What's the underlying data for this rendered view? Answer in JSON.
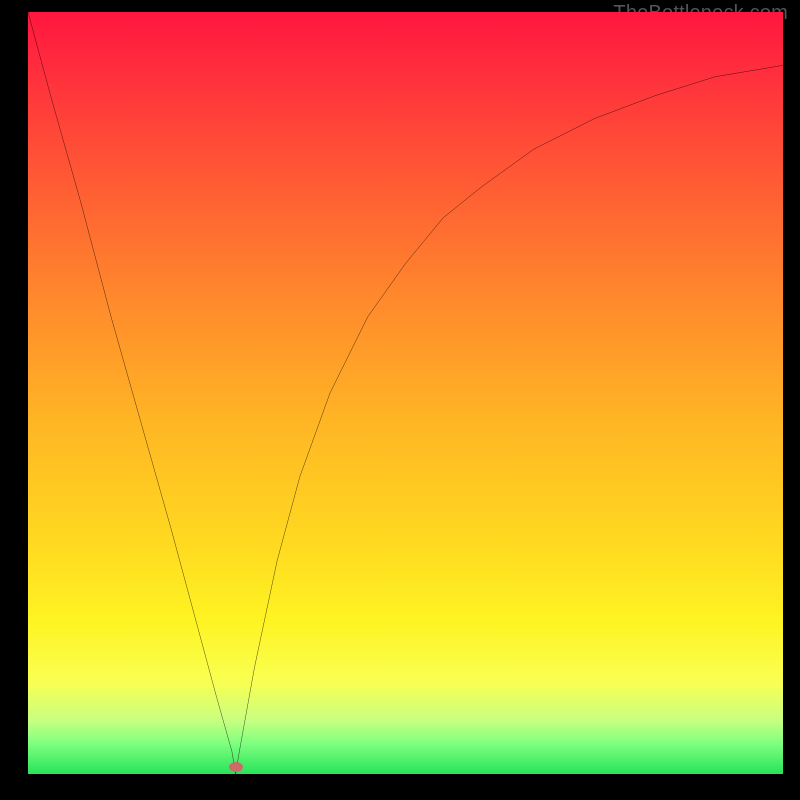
{
  "watermark": "TheBottleneck.com",
  "marker": {
    "x_pct": 27.5,
    "y_pct": 99.1
  },
  "chart_data": {
    "type": "line",
    "title": "",
    "xlabel": "",
    "ylabel": "",
    "xlim": [
      0,
      100
    ],
    "ylim": [
      0,
      100
    ],
    "x": [
      0,
      3,
      7,
      11,
      15,
      19,
      22,
      25,
      27,
      27.5,
      28,
      30,
      33,
      36,
      40,
      45,
      50,
      55,
      60,
      67,
      75,
      83,
      91,
      100
    ],
    "values": [
      100,
      89,
      75,
      60,
      46,
      32,
      21,
      10,
      3,
      0,
      3,
      14,
      28,
      39,
      50,
      60,
      67,
      73,
      77,
      82,
      86,
      89,
      91.5,
      93
    ],
    "series": [
      {
        "name": "bottleneck-curve",
        "values": [
          100,
          89,
          75,
          60,
          46,
          32,
          21,
          10,
          3,
          0,
          3,
          14,
          28,
          39,
          50,
          60,
          67,
          73,
          77,
          82,
          86,
          89,
          91.5,
          93
        ]
      }
    ],
    "annotations": [
      {
        "type": "marker",
        "x": 27.5,
        "y": 0
      }
    ],
    "background_gradient": [
      "#ff163f",
      "#ffda20",
      "#27e35a"
    ]
  }
}
